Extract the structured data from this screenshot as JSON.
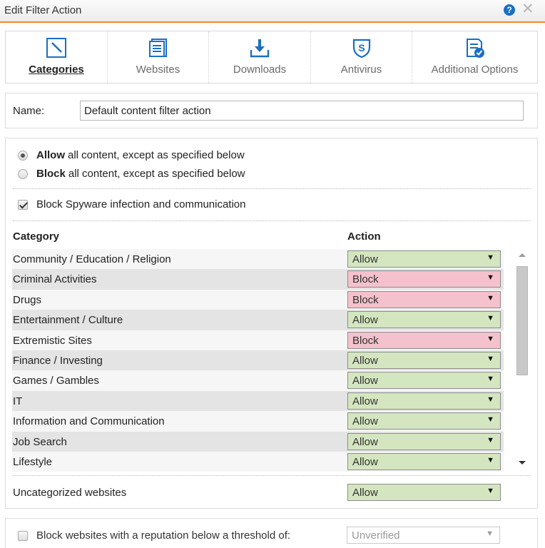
{
  "window": {
    "title": "Edit Filter Action",
    "help": "?",
    "close": "✕"
  },
  "tabs": [
    {
      "label": "Categories",
      "icon": "categories-icon",
      "active": true
    },
    {
      "label": "Websites",
      "icon": "websites-icon",
      "active": false
    },
    {
      "label": "Downloads",
      "icon": "downloads-icon",
      "active": false
    },
    {
      "label": "Antivirus",
      "icon": "antivirus-icon",
      "active": false
    },
    {
      "label": "Additional Options",
      "icon": "additional-options-icon",
      "active": false
    }
  ],
  "name_field": {
    "label": "Name:",
    "value": "Default content filter action"
  },
  "policy": {
    "allow": {
      "strong": "Allow",
      "rest": "all content, except as specified below",
      "selected": true
    },
    "block": {
      "strong": "Block",
      "rest": "all content, except as specified below",
      "selected": false
    }
  },
  "spyware": {
    "label": "Block Spyware infection and communication",
    "checked": true
  },
  "table": {
    "headers": {
      "category": "Category",
      "action": "Action"
    },
    "rows": [
      {
        "category": "Community / Education / Religion",
        "action": "Allow"
      },
      {
        "category": "Criminal Activities",
        "action": "Block"
      },
      {
        "category": "Drugs",
        "action": "Block"
      },
      {
        "category": "Entertainment / Culture",
        "action": "Allow"
      },
      {
        "category": "Extremistic Sites",
        "action": "Block"
      },
      {
        "category": "Finance / Investing",
        "action": "Allow"
      },
      {
        "category": "Games / Gambles",
        "action": "Allow"
      },
      {
        "category": "IT",
        "action": "Allow"
      },
      {
        "category": "Information and Communication",
        "action": "Allow"
      },
      {
        "category": "Job Search",
        "action": "Allow"
      },
      {
        "category": "Lifestyle",
        "action": "Allow"
      }
    ]
  },
  "uncategorized": {
    "label": "Uncategorized websites",
    "action": "Allow"
  },
  "reputation": {
    "label": "Block websites with a reputation below a threshold of:",
    "checked": false,
    "value": "Unverified"
  },
  "colors": {
    "accent": "#f08a24",
    "allow": "#d4e6bf",
    "block": "#f5c1cc",
    "help": "#1a6fc4"
  },
  "dropdown_arrow": "▼"
}
